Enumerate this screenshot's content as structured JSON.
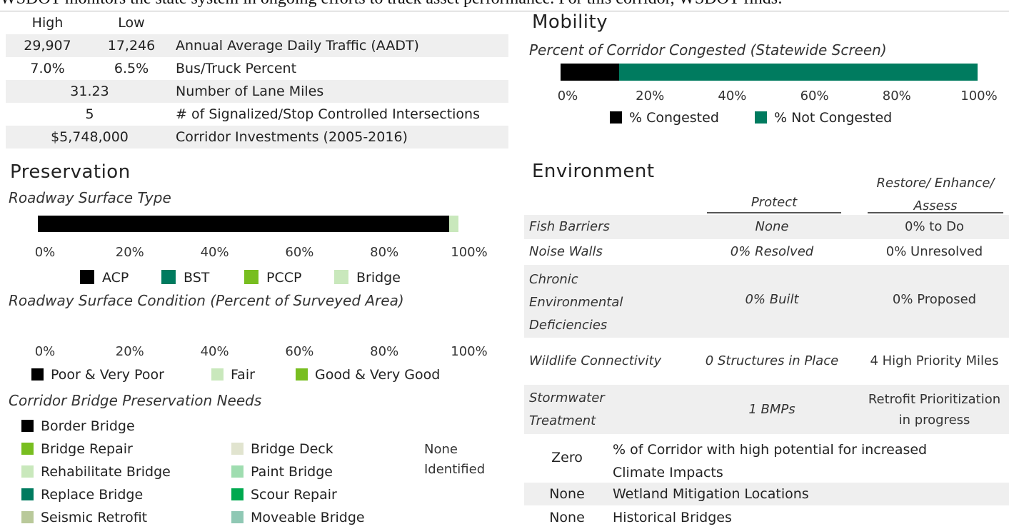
{
  "intro_text": "WSDOT monitors the state system in ongoing efforts to track asset performance. For this corridor, WSDOT finds:",
  "stats": {
    "header_high": "High",
    "header_low": "Low",
    "rows": [
      {
        "high": "29,907",
        "low": "17,246",
        "label": "Annual Average Daily Traffic (AADT)"
      },
      {
        "high": "7.0%",
        "low": "6.5%",
        "label": "Bus/Truck Percent"
      },
      {
        "value": "31.23",
        "label": "Number of Lane Miles"
      },
      {
        "value": "5",
        "label": "# of Signalized/Stop Controlled Intersections"
      },
      {
        "value": "$5,748,000",
        "label": "Corridor Investments (2005-2016)"
      }
    ]
  },
  "mobility": {
    "title": "Mobility",
    "subtitle": "Percent of Corridor Congested (Statewide Screen)",
    "legend": [
      {
        "label": "% Congested",
        "color": "#000000"
      },
      {
        "label": "% Not Congested",
        "color": "#007b5f"
      }
    ]
  },
  "preservation": {
    "title": "Preservation",
    "surface_type_subtitle": "Roadway Surface Type",
    "surface_type_legend": [
      {
        "label": "ACP",
        "color": "#000000"
      },
      {
        "label": "BST",
        "color": "#007b5f"
      },
      {
        "label": "PCCP",
        "color": "#78be20"
      },
      {
        "label": "Bridge",
        "color": "#c9e8bc"
      }
    ],
    "condition_subtitle": "Roadway Surface Condition (Percent of Surveyed Area)",
    "condition_legend": [
      {
        "label": "Poor & Very Poor",
        "color": "#000000"
      },
      {
        "label": "Fair",
        "color": "#c9e8bc"
      },
      {
        "label": "Good & Very Good",
        "color": "#78be20"
      }
    ],
    "bridge_needs_subtitle": "Corridor Bridge Preservation Needs",
    "bridge_needs_col1": [
      {
        "label": "Border Bridge",
        "color": "#000000"
      },
      {
        "label": "Bridge Repair",
        "color": "#78be20"
      },
      {
        "label": "Rehabilitate Bridge",
        "color": "#c9e8bc"
      },
      {
        "label": "Replace Bridge",
        "color": "#007b5f"
      },
      {
        "label": "Seismic Retrofit",
        "color": "#b9c99a"
      }
    ],
    "bridge_needs_col2": [
      {
        "label": "Bridge Deck",
        "color": "#e1e4cf"
      },
      {
        "label": "Paint Bridge",
        "color": "#9fddb0"
      },
      {
        "label": "Scour Repair",
        "color": "#00a94f"
      },
      {
        "label": "Moveable Bridge",
        "color": "#8fc8b4"
      }
    ],
    "bridge_needs_status_line1": "None",
    "bridge_needs_status_line2": "Identified"
  },
  "environment": {
    "title": "Environment",
    "col_protect": "Protect",
    "col_restore_line1": "Restore/ Enhance/",
    "col_restore_line2": "Assess",
    "rows": [
      {
        "label": "Fish Barriers",
        "protect": "None",
        "restore": "0% to Do"
      },
      {
        "label": "Noise Walls",
        "protect": "0% Resolved",
        "restore": "0% Unresolved"
      },
      {
        "label_lines": [
          "Chronic",
          "Environmental",
          "Deficiencies"
        ],
        "protect": "0% Built",
        "restore": "0% Proposed"
      },
      {
        "label": "Wildlife Connectivity",
        "protect": "0 Structures in Place",
        "restore": "4 High Priority Miles"
      },
      {
        "label_lines": [
          "Stormwater",
          "Treatment"
        ],
        "protect": "1 BMPs",
        "restore_lines": [
          "Retrofit Prioritization",
          "in progress"
        ]
      }
    ],
    "bottom_rows": [
      {
        "value": "Zero",
        "label_lines": [
          "% of Corridor with high potential for increased",
          "Climate Impacts"
        ]
      },
      {
        "value": "None",
        "label": "Wetland Mitigation Locations"
      },
      {
        "value": "None",
        "label": "Historical Bridges"
      }
    ]
  },
  "chart_data": [
    {
      "type": "bar",
      "title": "Percent of Corridor Congested (Statewide Screen)",
      "orientation": "horizontal-stacked",
      "series": [
        {
          "name": "% Congested",
          "values": [
            14
          ]
        },
        {
          "name": "% Not Congested",
          "values": [
            86
          ]
        }
      ],
      "xlim": [
        0,
        100
      ],
      "tick_labels": [
        "0%",
        "20%",
        "40%",
        "60%",
        "80%",
        "100%"
      ]
    },
    {
      "type": "bar",
      "title": "Roadway Surface Type",
      "orientation": "horizontal-stacked",
      "series": [
        {
          "name": "ACP",
          "values": [
            97.8
          ]
        },
        {
          "name": "BST",
          "values": [
            0
          ]
        },
        {
          "name": "PCCP",
          "values": [
            0
          ]
        },
        {
          "name": "Bridge",
          "values": [
            2.2
          ]
        }
      ],
      "xlim": [
        0,
        100
      ],
      "tick_labels": [
        "0%",
        "20%",
        "40%",
        "60%",
        "80%",
        "100%"
      ]
    },
    {
      "type": "bar",
      "title": "Roadway Surface Condition (Percent of Surveyed Area)",
      "orientation": "horizontal-stacked",
      "series": [
        {
          "name": "Poor & Very Poor",
          "values": [
            0
          ]
        },
        {
          "name": "Fair",
          "values": [
            0
          ]
        },
        {
          "name": "Good & Very Good",
          "values": [
            0
          ]
        }
      ],
      "xlim": [
        0,
        100
      ],
      "tick_labels": [
        "0%",
        "20%",
        "40%",
        "60%",
        "80%",
        "100%"
      ]
    }
  ]
}
